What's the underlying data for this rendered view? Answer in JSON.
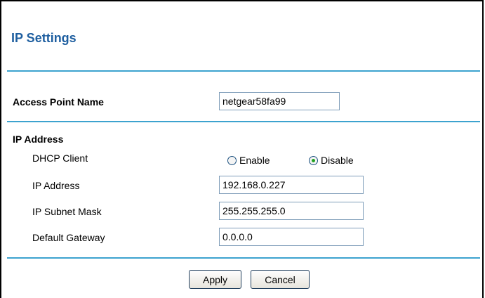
{
  "page": {
    "title": "IP Settings"
  },
  "access_point": {
    "label": "Access Point Name",
    "value": "netgear58fa99"
  },
  "ip_section": {
    "heading": "IP Address",
    "dhcp": {
      "label": "DHCP Client",
      "options": [
        "Enable",
        "Disable"
      ],
      "selected": "Disable"
    },
    "ip_address": {
      "label": "IP Address",
      "value": "192.168.0.227"
    },
    "subnet_mask": {
      "label": "IP Subnet Mask",
      "value": "255.255.255.0"
    },
    "gateway": {
      "label": "Default Gateway",
      "value": "0.0.0.0"
    }
  },
  "buttons": {
    "apply": "Apply",
    "cancel": "Cancel"
  },
  "colors": {
    "title": "#1f5fa0",
    "rule": "#3da3cf",
    "radio_selected": "#21a121"
  }
}
